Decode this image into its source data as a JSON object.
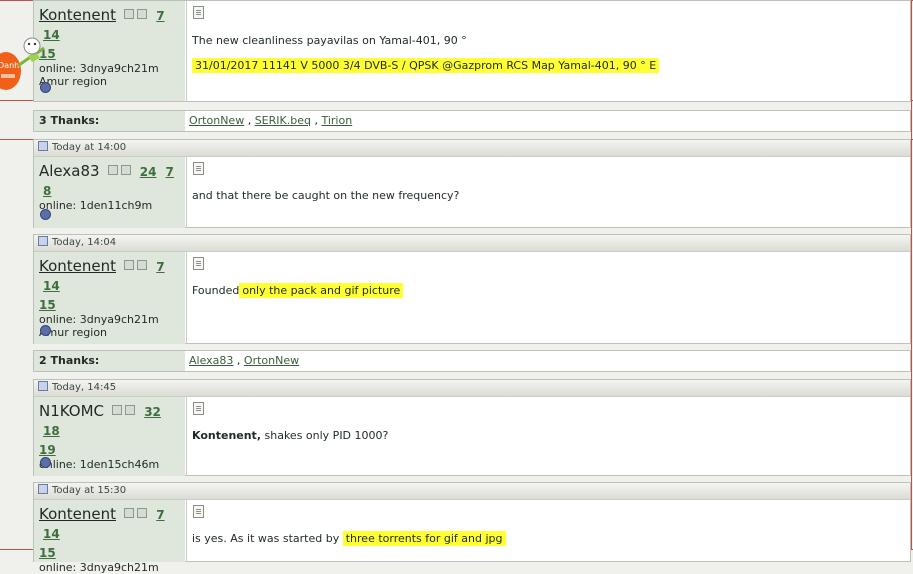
{
  "posts": [
    {
      "header": "",
      "username": "Kontenent",
      "rep_nums": [
        "7",
        "14",
        "15"
      ],
      "online": "online: 3dnya9ch21m",
      "region": "Amur region",
      "line1": "The new cleanliness payavilas on Yamal-401, 90 °",
      "line2": "31/01/2017 11141 V 5000 3/4 DVB-S / QPSK @Gazprom RCS Map Yamal-401, 90 ° E"
    },
    {
      "header": "Today at 14:00",
      "username": "Alexa83",
      "rep_nums": [
        "24",
        "7",
        "8"
      ],
      "online": "online: 1den11ch9m",
      "line1": "and that there be caught on the new frequency?"
    },
    {
      "header": "Today, 14:04",
      "username": "Kontenent",
      "rep_nums": [
        "7",
        "14",
        "15"
      ],
      "online": "online: 3dnya9ch21m",
      "region": "Amur region",
      "pre": "Founded",
      "hl": "only the pack and gif picture"
    },
    {
      "header": "Today, 14:45",
      "username": "N1KOMC",
      "rep_nums": [
        "32",
        "18",
        "19"
      ],
      "online": "online: 1den15ch46m",
      "bold": "Kontenent,",
      "rest": "shakes only PID 1000?"
    },
    {
      "header": "Today at 15:30",
      "username": "Kontenent",
      "rep_nums": [
        "7",
        "14",
        "15"
      ],
      "online": "online: 3dnya9ch21m",
      "pre": "is yes. As it was started by",
      "hl": "three torrents for gif and jpg"
    }
  ],
  "thanks": [
    {
      "label": "3 Thanks:",
      "names": [
        "OrtonNew",
        "SERIK.beq",
        "Tirion"
      ]
    },
    {
      "label": "2 Thanks:",
      "names": [
        "Alexa83",
        "OrtonNew"
      ]
    }
  ],
  "avatar_text": "Danh"
}
